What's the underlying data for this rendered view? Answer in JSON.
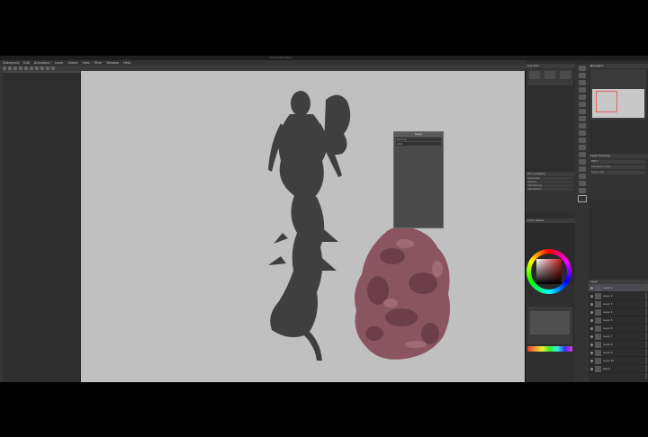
{
  "app": {
    "window_title": "Clip Studio Paint",
    "menus": [
      "Dokument",
      "Edit",
      "Animation",
      "Layer",
      "Select",
      "View",
      "Filter",
      "Window",
      "Help"
    ]
  },
  "floating_window": {
    "title": "Layer",
    "rows": [
      "Normal",
      "100"
    ]
  },
  "panels": {
    "sub_tool": "Sub Tool",
    "tool_property": "Tool property",
    "color_wheel": "Color Wheel",
    "navigator": "Navigator",
    "layer_property": "Layer Property",
    "layer": "Layer"
  },
  "tool_property_rows": [
    "Brush Size",
    "Opacity",
    "Anti-aliasing",
    "Stabilization"
  ],
  "layer_property_rows": [
    "Effect",
    "Expression color",
    "Layer color"
  ],
  "layers": [
    "Layer 1",
    "Layer 2",
    "Layer 3",
    "Layer 4",
    "Layer 5",
    "Layer 6",
    "Layer 7",
    "Layer 8",
    "Layer 9",
    "Layer 10",
    "Paper"
  ],
  "colors": {
    "canvas": "#c0c0c0",
    "creature": "#3f3f3f",
    "blob": "#8a5560",
    "ui_dark": "#2e2e2e"
  },
  "icons": [
    "eye-icon",
    "brush-icon",
    "pen-icon",
    "eraser-icon",
    "fill-icon",
    "move-icon"
  ]
}
